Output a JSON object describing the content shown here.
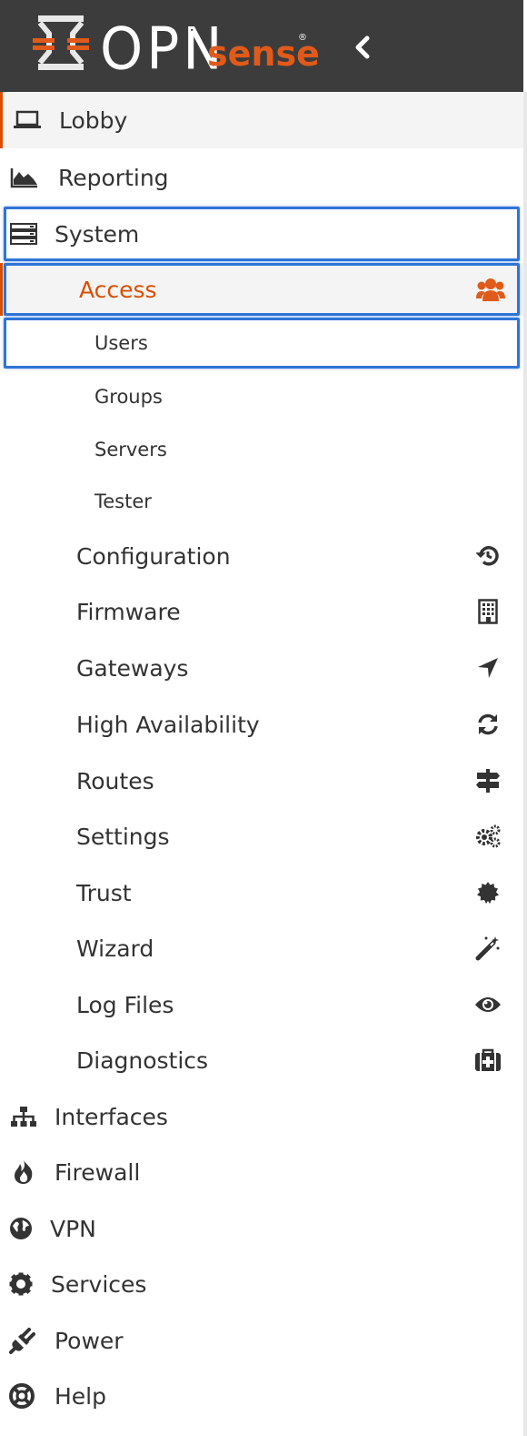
{
  "brand": {
    "text_left": "OPN",
    "text_right": "sense",
    "trademark": "®"
  },
  "colors": {
    "header_bg": "#3c3c3c",
    "accent": "#d94f00",
    "highlight": "#2f74d8"
  },
  "menu": {
    "lobby": "Lobby",
    "reporting": "Reporting",
    "system": "System",
    "access": "Access",
    "users": "Users",
    "groups": "Groups",
    "servers": "Servers",
    "tester": "Tester",
    "configuration": "Configuration",
    "firmware": "Firmware",
    "gateways": "Gateways",
    "high_availability": "High Availability",
    "routes": "Routes",
    "settings": "Settings",
    "trust": "Trust",
    "wizard": "Wizard",
    "log_files": "Log Files",
    "diagnostics": "Diagnostics",
    "interfaces": "Interfaces",
    "firewall": "Firewall",
    "vpn": "VPN",
    "services": "Services",
    "power": "Power",
    "help": "Help"
  }
}
